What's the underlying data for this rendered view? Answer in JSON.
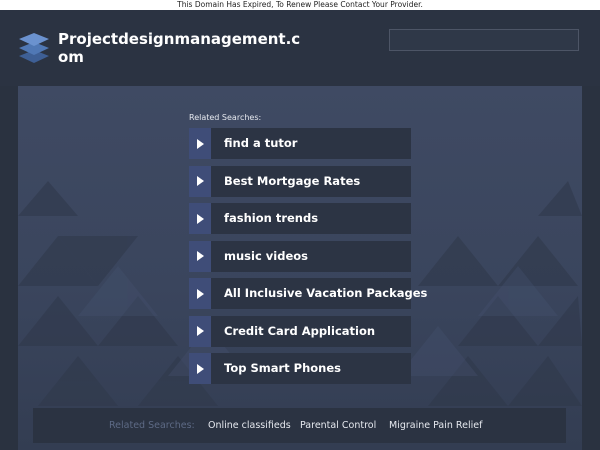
{
  "notice": "This Domain Has Expired, To Renew Please Contact Your Provider.",
  "header": {
    "site_title": "Projectdesignmanagement.com",
    "logo_icon": "stacked-layers-icon",
    "search": {
      "placeholder": ""
    }
  },
  "related": {
    "heading": "Related Searches:",
    "links": [
      "find a tutor",
      "Best Mortgage Rates",
      "fashion trends",
      "music videos",
      "All Inclusive Vacation Packages",
      "Credit Card Application",
      "Top Smart Phones"
    ]
  },
  "footer": {
    "heading": "Related Searches:",
    "links": [
      "Online classifieds",
      "Parental Control",
      "Migraine Pain Relief"
    ]
  },
  "colors": {
    "page_background": "#2a3240",
    "panel": "#3f4a63",
    "link_background": "#2c3444",
    "arrow_background": "#3f4d78",
    "footer_heading": "#5d6a85"
  }
}
